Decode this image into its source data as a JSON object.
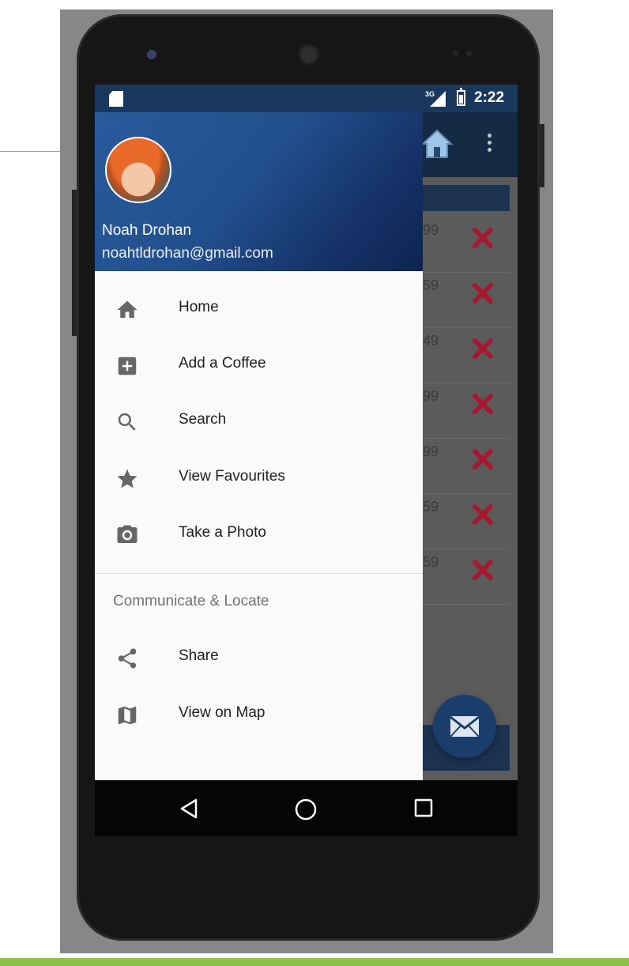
{
  "status_bar": {
    "network": "3G",
    "time": "2:22"
  },
  "drawer": {
    "header": {
      "user_name": "Noah Drohan",
      "user_email": "noahtldrohan@gmail.com"
    },
    "items": [
      {
        "label": "Home",
        "icon": "home-icon"
      },
      {
        "label": "Add a Coffee",
        "icon": "add-box-icon"
      },
      {
        "label": "Search",
        "icon": "search-icon"
      },
      {
        "label": "View Favourites",
        "icon": "star-icon"
      },
      {
        "label": "Take a Photo",
        "icon": "camera-icon"
      }
    ],
    "section_title": "Communicate & Locate",
    "section_items": [
      {
        "label": "Share",
        "icon": "share-icon"
      },
      {
        "label": "View on Map",
        "icon": "map-icon"
      }
    ]
  },
  "background_list": {
    "visible_prices": [
      "99",
      "59",
      "49",
      "99",
      "99",
      "59",
      "59"
    ],
    "delete_icon": "close-icon",
    "delete_color": "#c62828"
  },
  "fab": {
    "icon": "mail-icon"
  },
  "nav": {
    "back": "back-icon",
    "home": "circle-home-icon",
    "recents": "recents-icon"
  },
  "colors": {
    "primary": "#1a3d6c",
    "status_bar": "#18385e",
    "accent_green": "#8bc34a"
  }
}
